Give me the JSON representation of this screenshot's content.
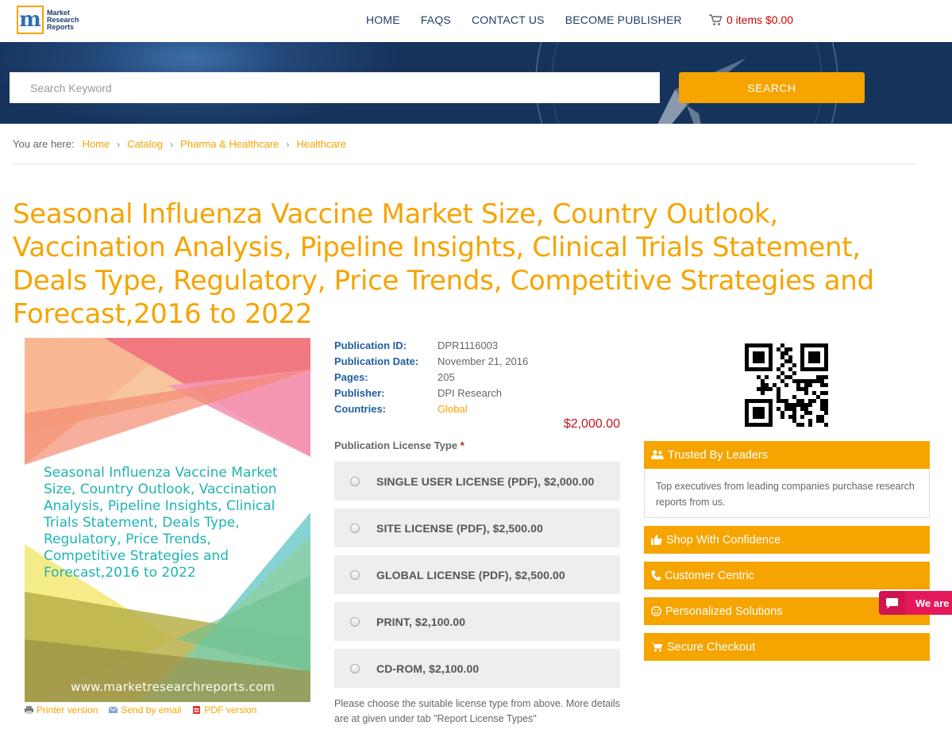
{
  "header": {
    "logo_text": "Market Research Reports",
    "logo_letter": "m",
    "nav": [
      "HOME",
      "FAQS",
      "CONTACT US",
      "BECOME PUBLISHER"
    ],
    "cart": "0 items $0.00"
  },
  "search": {
    "placeholder": "Search Keyword",
    "button": "SEARCH"
  },
  "breadcrumb": {
    "label": "You are here:",
    "items": [
      "Home",
      "Catalog",
      "Pharma & Healthcare",
      "Healthcare"
    ]
  },
  "title": "Seasonal Influenza Vaccine Market Size, Country Outlook, Vaccination Analysis, Pipeline Insights, Clinical Trials Statement, Deals Type, Regulatory, Price Trends, Competitive Strategies and Forecast,2016 to 2022",
  "cover": {
    "title": "Seasonal Influenza Vaccine Market Size, Country Outlook, Vaccination Analysis, Pipeline Insights, Clinical Trials Statement, Deals Type, Regulatory, Price Trends, Competitive Strategies and Forecast,2016 to 2022",
    "url": "www.marketresearchreports.com",
    "links": [
      "Printer version",
      "Send by email",
      "PDF version"
    ]
  },
  "meta": [
    {
      "label": "Publication ID:",
      "value": "DPR1116003"
    },
    {
      "label": "Publication Date:",
      "value": "November 21, 2016"
    },
    {
      "label": "Pages:",
      "value": "205"
    },
    {
      "label": "Publisher:",
      "value": "DPI Research"
    },
    {
      "label": "Countries:",
      "value": "Global"
    }
  ],
  "price": "$2,000.00",
  "license": {
    "heading": "Publication License Type",
    "required_mark": "*",
    "options": [
      "SINGLE USER LICENSE (PDF), $2,000.00",
      "SITE LICENSE (PDF), $2,500.00",
      "GLOBAL LICENSE (PDF), $2,500.00",
      "PRINT, $2,100.00",
      "CD-ROM, $2,100.00"
    ],
    "note": "Please choose the suitable license type from above. More details are at given under tab \"Report License Types\""
  },
  "panels": {
    "trusted": {
      "title": "Trusted By Leaders",
      "body": "Top executives from leading companies purchase research reports from us."
    },
    "items": [
      "Shop With Confidence",
      "Customer Centric",
      "Personalized Solutions",
      "Secure Checkout"
    ]
  },
  "chat": "We are",
  "colors": {
    "accent": "#f5a400",
    "navy": "#1f3e66",
    "price_red": "#c5161d",
    "chat_pink": "#e5185a"
  }
}
